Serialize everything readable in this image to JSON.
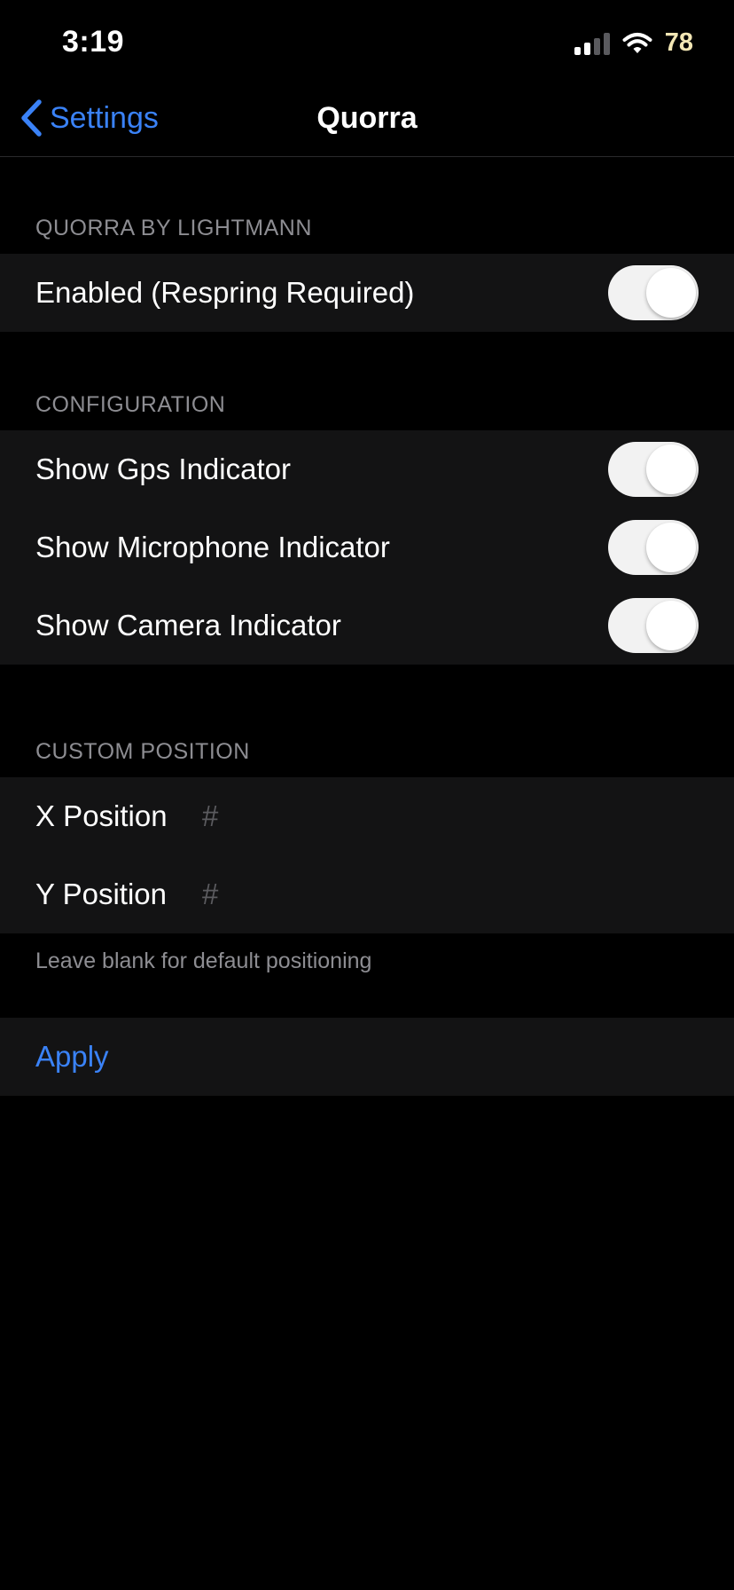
{
  "colors": {
    "accent": "#3a82f7",
    "background": "#000000",
    "cell": "#131314",
    "toggle_track": "#f2f2f2",
    "secondary_text": "#8d8d92",
    "battery_text": "#f2e6b4"
  },
  "status_bar": {
    "time": "3:19",
    "battery": "78",
    "icons": [
      "signal-icon",
      "wifi-icon"
    ]
  },
  "nav": {
    "back_label": "Settings",
    "back_icon": "chevron-left-icon",
    "title": "Quorra"
  },
  "sections": {
    "main": {
      "header": "QUORRA BY LIGHTMANN",
      "enabled": {
        "label": "Enabled (Respring Required)",
        "on": true
      }
    },
    "configuration": {
      "header": "CONFIGURATION",
      "gps": {
        "label": "Show Gps Indicator",
        "on": true
      },
      "microphone": {
        "label": "Show Microphone Indicator",
        "on": true
      },
      "camera": {
        "label": "Show Camera Indicator",
        "on": true
      }
    },
    "custom_position": {
      "header": "CUSTOM POSITION",
      "x": {
        "label": "X Position",
        "value": "",
        "placeholder": "#"
      },
      "y": {
        "label": "Y Position",
        "value": "",
        "placeholder": "#"
      },
      "footer": "Leave blank for default positioning"
    },
    "actions": {
      "apply_label": "Apply"
    }
  }
}
